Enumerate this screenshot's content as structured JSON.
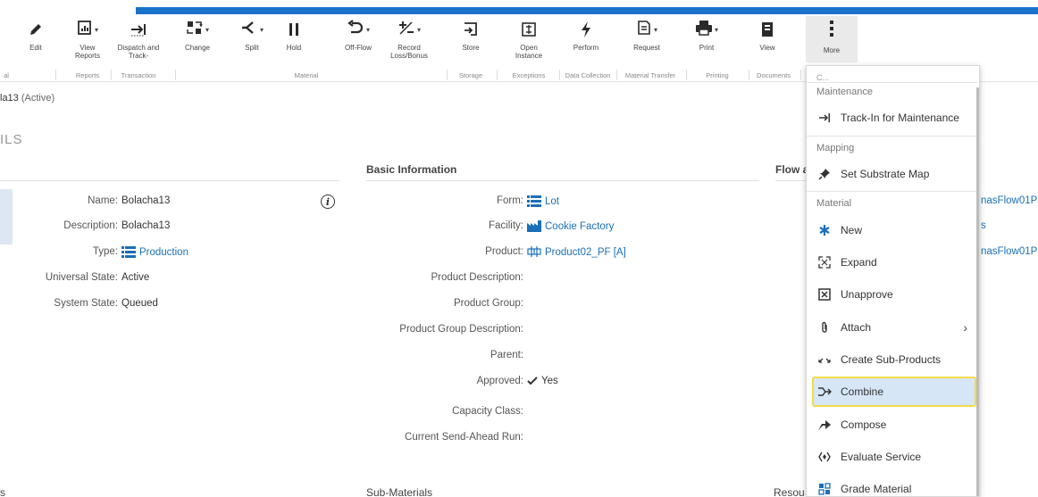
{
  "ribbon": {
    "buttons": [
      {
        "label": "Edit",
        "icon": "pencil-icon"
      },
      {
        "label": "View Reports",
        "icon": "report-icon"
      },
      {
        "label": "Dispatch and Track-",
        "icon": "dispatch-icon"
      },
      {
        "label": "Change",
        "icon": "change-icon"
      },
      {
        "label": "Split",
        "icon": "split-icon"
      },
      {
        "label": "Hold",
        "icon": "pause-icon"
      },
      {
        "label": "Off-Flow",
        "icon": "undo-icon"
      },
      {
        "label": "Record Loss/Bonus",
        "icon": "plus-minus-icon"
      },
      {
        "label": "Store",
        "icon": "store-icon"
      },
      {
        "label": "Open Instance",
        "icon": "open-instance-icon"
      },
      {
        "label": "Perform",
        "icon": "lightning-icon"
      },
      {
        "label": "Request",
        "icon": "request-icon"
      },
      {
        "label": "Print",
        "icon": "printer-icon"
      },
      {
        "label": "View",
        "icon": "book-icon"
      },
      {
        "label": "More",
        "icon": "kebab-icon"
      }
    ],
    "groups": [
      "al",
      "Reports",
      "Transaction",
      "Material",
      "Storage",
      "Exceptions",
      "Data Collection",
      "Material Transfer",
      "Printing",
      "Documents"
    ]
  },
  "breadcrumb": {
    "name": "la13",
    "status": "(Active)"
  },
  "section_heading": "ILS",
  "columns": {
    "basic_info_title": "Basic Information",
    "flow_title": "Flow a",
    "sub_materials_title": "Sub-Materials",
    "left_bottom_title": "s",
    "resources_title": "Resou"
  },
  "left_fields": [
    {
      "key": "Name:",
      "value": "Bolacha13"
    },
    {
      "key": "Description:",
      "value": "Bolacha13"
    },
    {
      "key": "Type:",
      "value": "Production"
    },
    {
      "key": "Universal State:",
      "value": "Active"
    },
    {
      "key": "System State:",
      "value": "Queued"
    }
  ],
  "basic_fields": [
    {
      "key": "Form:",
      "value": "Lot"
    },
    {
      "key": "Facility:",
      "value": "Cookie Factory"
    },
    {
      "key": "Product:",
      "value": "Product02_PF [A]"
    },
    {
      "key": "Product Description:",
      "value": ""
    },
    {
      "key": "Product Group:",
      "value": ""
    },
    {
      "key": "Product Group Description:",
      "value": ""
    },
    {
      "key": "Parent:",
      "value": ""
    },
    {
      "key": "Approved:",
      "value": "Yes"
    },
    {
      "key": "Capacity Class:",
      "value": ""
    },
    {
      "key": "Current Send-Ahead Run:",
      "value": ""
    }
  ],
  "right_clip": [
    "nasFlow01P",
    "s",
    "nasFlow01P"
  ],
  "menu": {
    "clipped_top": "C...",
    "headers": [
      "Maintenance",
      "Mapping",
      "Material"
    ],
    "items": [
      {
        "label": "Track-In for Maintenance",
        "icon": "track-in-icon"
      },
      {
        "label": "Set Substrate Map",
        "icon": "pin-icon"
      },
      {
        "label": "New",
        "icon": "asterisk-icon"
      },
      {
        "label": "Expand",
        "icon": "expand-icon"
      },
      {
        "label": "Unapprove",
        "icon": "unapprove-icon"
      },
      {
        "label": "Attach",
        "icon": "paperclip-icon"
      },
      {
        "label": "Create Sub-Products",
        "icon": "create-sub-products-icon"
      },
      {
        "label": "Combine",
        "icon": "combine-icon"
      },
      {
        "label": "Compose",
        "icon": "compose-icon"
      },
      {
        "label": "Evaluate Service",
        "icon": "evaluate-icon"
      },
      {
        "label": "Grade Material",
        "icon": "grade-icon"
      }
    ]
  }
}
